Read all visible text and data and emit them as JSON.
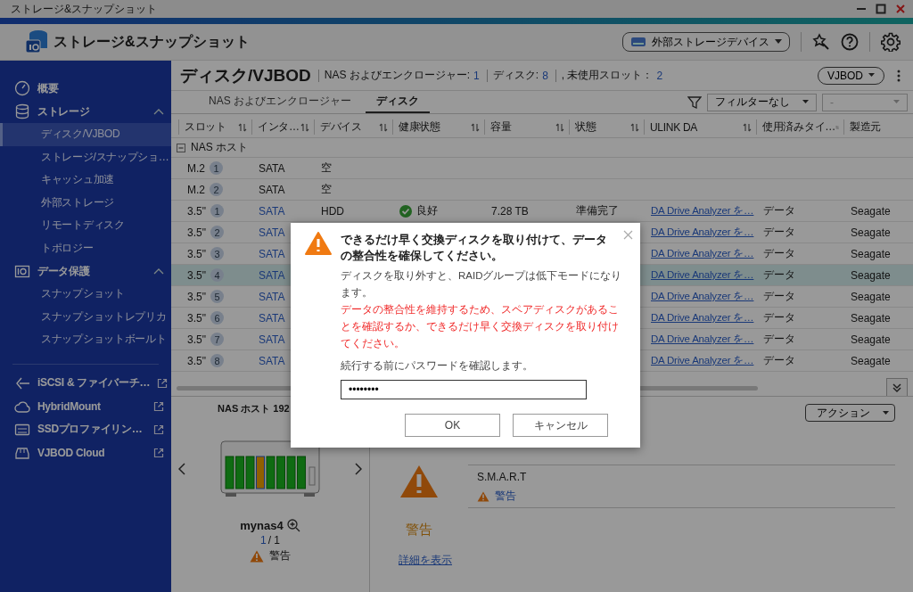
{
  "window": {
    "title": "ストレージ&スナップショット"
  },
  "header": {
    "app_title": "ストレージ&スナップショット",
    "external_button": "外部ストレージデバイス"
  },
  "sidebar": {
    "items": [
      {
        "label": "概要",
        "kind": "page"
      },
      {
        "label": "ストレージ",
        "kind": "group",
        "expanded": true,
        "children": [
          {
            "label": "ディスク/VJBOD",
            "selected": true
          },
          {
            "label": "ストレージ/スナップショ…",
            "selected": false
          },
          {
            "label": "キャッシュ加速",
            "selected": false
          },
          {
            "label": "外部ストレージ",
            "selected": false
          },
          {
            "label": "リモートディスク",
            "selected": false
          },
          {
            "label": "トポロジー",
            "selected": false
          }
        ]
      },
      {
        "label": "データ保護",
        "kind": "group",
        "expanded": true,
        "children": [
          {
            "label": "スナップショット",
            "selected": false
          },
          {
            "label": "スナップショットレプリカ",
            "selected": false
          },
          {
            "label": "スナップショットボールト",
            "selected": false
          }
        ]
      },
      {
        "label": "iSCSI & ファイバーチ…",
        "kind": "external"
      },
      {
        "label": "HybridMount",
        "kind": "external"
      },
      {
        "label": "SSDプロファイリン…",
        "kind": "external"
      },
      {
        "label": "VJBOD Cloud",
        "kind": "external"
      }
    ]
  },
  "page": {
    "title": "ディスク/VJBOD",
    "stats": [
      {
        "label": "NAS およびエンクロージャー:",
        "value": "1"
      },
      {
        "label": "ディスク:",
        "value": "8"
      },
      {
        "label": ", 未使用スロット：",
        "value": "2"
      }
    ],
    "view_button": "VJBOD"
  },
  "tabs": [
    {
      "label": "NAS およびエンクロージャー",
      "selected": false
    },
    {
      "label": "ディスク",
      "selected": true
    }
  ],
  "filter": {
    "value": "フィルターなし",
    "secondary": "-"
  },
  "table": {
    "columns": [
      "スロット",
      "インタ…",
      "デバイス",
      "健康状態",
      "容量",
      "状態",
      "ULINK DA",
      "使用済みタイ…",
      "製造元"
    ],
    "group": {
      "label": "NAS ホスト",
      "expanded": true
    },
    "rows": [
      {
        "slot": "M.2",
        "number": "1",
        "selected": false,
        "interface": {
          "text": "SATA",
          "link": false
        },
        "device": "空"
      },
      {
        "slot": "M.2",
        "number": "2",
        "selected": false,
        "interface": {
          "text": "SATA",
          "link": false
        },
        "device": "空"
      },
      {
        "slot": "3.5\"",
        "number": "1",
        "selected": false,
        "interface": {
          "text": "SATA",
          "link": true
        },
        "device": "HDD",
        "health": {
          "label": "良好",
          "kind": "good"
        },
        "capacity": "7.28 TB",
        "status": "準備完了",
        "ulink": "DA Drive Analyzer を…",
        "used_type": "データ",
        "vendor": "Seagate"
      },
      {
        "slot": "3.5\"",
        "number": "2",
        "selected": false,
        "interface": {
          "text": "SATA",
          "link": true
        },
        "ulink": "DA Drive Analyzer を…",
        "used_type": "データ",
        "vendor": "Seagate"
      },
      {
        "slot": "3.5\"",
        "number": "3",
        "selected": false,
        "interface": {
          "text": "SATA",
          "link": true
        },
        "ulink": "DA Drive Analyzer を…",
        "used_type": "データ",
        "vendor": "Seagate"
      },
      {
        "slot": "3.5\"",
        "number": "4",
        "selected": true,
        "interface": {
          "text": "SATA",
          "link": true
        },
        "ulink": "DA Drive Analyzer を…",
        "used_type": "データ",
        "vendor": "Seagate"
      },
      {
        "slot": "3.5\"",
        "number": "5",
        "selected": false,
        "interface": {
          "text": "SATA",
          "link": true
        },
        "ulink": "DA Drive Analyzer を…",
        "used_type": "データ",
        "vendor": "Seagate"
      },
      {
        "slot": "3.5\"",
        "number": "6",
        "selected": false,
        "interface": {
          "text": "SATA",
          "link": true
        },
        "ulink": "DA Drive Analyzer を…",
        "used_type": "データ",
        "vendor": "Seagate"
      },
      {
        "slot": "3.5\"",
        "number": "7",
        "selected": false,
        "interface": {
          "text": "SATA",
          "link": true
        },
        "ulink": "DA Drive Analyzer を…",
        "used_type": "データ",
        "vendor": "Seagate"
      },
      {
        "slot": "3.5\"",
        "number": "8",
        "selected": false,
        "interface": {
          "text": "SATA",
          "link": true
        },
        "ulink": "DA Drive Analyzer を…",
        "used_type": "データ",
        "vendor": "Seagate"
      }
    ]
  },
  "enclosure": {
    "title": "NAS ホスト 192",
    "name": "mynas4",
    "page_current": "1",
    "page_total": "/ 1",
    "status": "警告",
    "bays": [
      {
        "kind": "good"
      },
      {
        "kind": "good"
      },
      {
        "kind": "good"
      },
      {
        "kind": "warning"
      },
      {
        "kind": "good"
      },
      {
        "kind": "good"
      },
      {
        "kind": "good"
      },
      {
        "kind": "good"
      }
    ]
  },
  "detail": {
    "status": "警告",
    "link": "詳細を表示",
    "action_button": "アクション",
    "smart_label": "S.M.A.R.T",
    "smart_status": "警告"
  },
  "dialog": {
    "title": "できるだけ早く交換ディスクを取り付けて、データの整合性を確保してください。",
    "message": "ディスクを取り外すと、RAIDグループは低下モードになります。",
    "warning": "データの整合性を維持するため、スペアディスクがあることを確認するか、できるだけ早く交換ディスクを取り付けてください。",
    "prompt": "続行する前にパスワードを確認します。",
    "password": "••••••••",
    "buttons": [
      "OK",
      "キャンセル"
    ]
  }
}
